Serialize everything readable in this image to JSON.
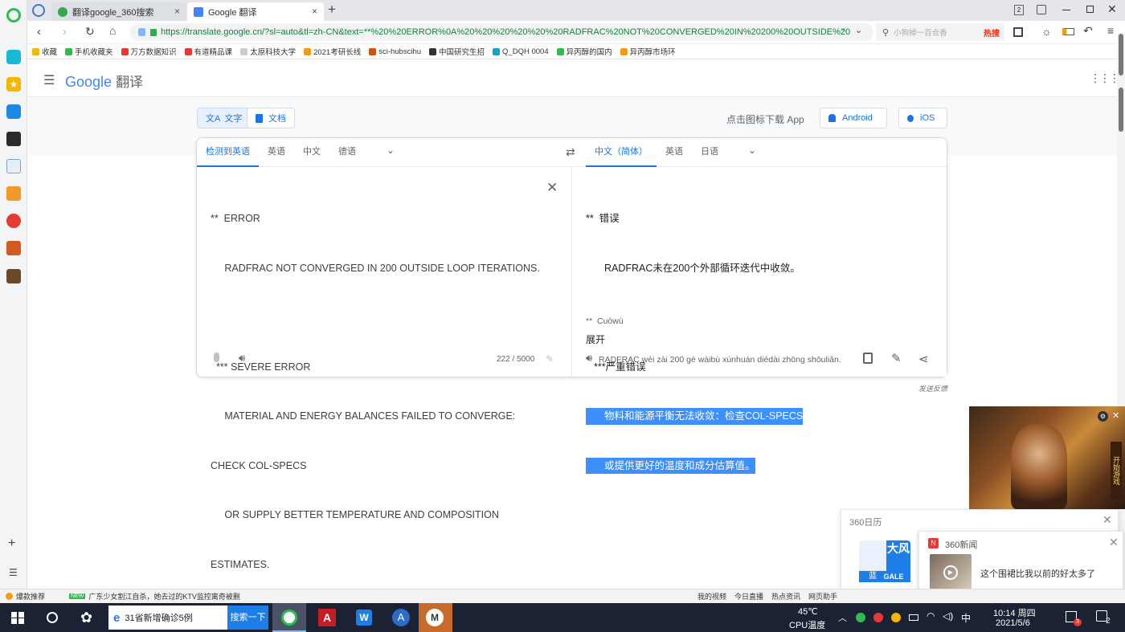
{
  "browser": {
    "tabs": [
      {
        "label": "翻译google_360搜索"
      },
      {
        "label": "Google 翻译"
      }
    ],
    "url": "https://translate.google.cn/?sl=auto&tl=zh-CN&text=**%20%20ERROR%0A%20%20%20%20%20%20RADFRAC%20NOT%20CONVERGED%20IN%20200%20OUTSIDE%20",
    "search_placeholder": "小狗掉一百合香",
    "hot_label": "热搜",
    "tab_count": "2",
    "bookmarks": [
      "收藏",
      "手机收藏夹",
      "万方数据知识",
      "有道精品课",
      "太原科技大学",
      "2021考研长线",
      "sci-hubscihu",
      "中国研究生招",
      "Q_DQH 0004",
      "异丙醇的国内",
      "异丙醇市场环"
    ]
  },
  "app": {
    "brand_google": "Google",
    "brand_translate": "翻译",
    "mode_text": "文字",
    "mode_doc": "文档",
    "download_text": "点击图标下载 App",
    "android": "Android",
    "ios": "iOS"
  },
  "source_langs": [
    "检测到英语",
    "英语",
    "中文",
    "德语"
  ],
  "target_langs": [
    "中文（简体）",
    "英语",
    "日语"
  ],
  "source_text": {
    "l1": "**  ERROR",
    "l2": "     RADFRAC NOT CONVERGED IN 200 OUTSIDE LOOP ITERATIONS.",
    "l3": "  *** SEVERE ERROR",
    "l4": "     MATERIAL AND ENERGY BALANCES FAILED TO CONVERGE:",
    "l5": "CHECK COL-SPECS",
    "l6": "     OR SUPPLY BETTER TEMPERATURE AND COMPOSITION",
    "l7": "ESTIMATES."
  },
  "char_count": "222 / 5000",
  "target_text": {
    "l1": "**  错误",
    "l2": "RADFRAC未在200个外部循环迭代中收敛。",
    "l3": "***严重错误",
    "l4": "物料和能源平衡无法收敛：检查COL-SPECS",
    "l5": "或提供更好的温度和成分估算值。"
  },
  "romanization": {
    "l1": "**  Cuòwù",
    "l2": "RADFRAC wèi zài 200 gè wàibù xúnhuán diédài zhōng shōuliǎn."
  },
  "expand_label": "展开",
  "feedback": "发送反馈",
  "popups": {
    "calendar_title": "360日历",
    "calendar_big": "大风",
    "calendar_blue": "蓝",
    "calendar_gale": "GALE",
    "news_title": "360新闻",
    "news_text": "这个围裙比我以前的好太多了",
    "game_text": "开始游戏"
  },
  "statusbar": {
    "left1": "爆款推荐",
    "new_badge": "NEW",
    "news": "广东少女割江自杀，她去过的KTV监控离奇被删",
    "r1": "我的视频",
    "r2": "今日直播",
    "r3": "热点资讯",
    "r4": "网页助手"
  },
  "taskbar": {
    "search_text": "31省新增确诊5例",
    "search_btn": "搜索一下",
    "temp": "45℃",
    "temp_label": "CPU温度",
    "ime": "中",
    "time": "10:14 周四",
    "date": "2021/5/6",
    "notif_count": "3",
    "msg_count": "2"
  },
  "colors": {
    "accent": "#1a73e8",
    "highlight": "#3d8ffb",
    "taskbar": "#1b2233"
  }
}
